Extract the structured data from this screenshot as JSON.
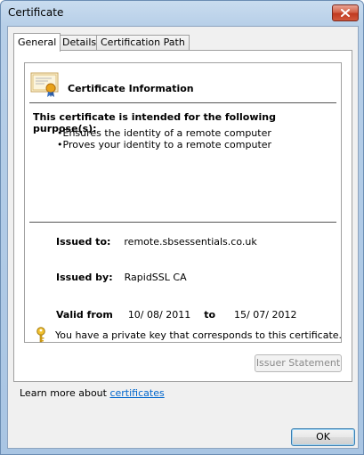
{
  "window": {
    "title": "Certificate"
  },
  "tabs": [
    {
      "label": "General",
      "active": true
    },
    {
      "label": "Details",
      "active": false
    },
    {
      "label": "Certification Path",
      "active": false
    }
  ],
  "general": {
    "section_title": "Certificate Information",
    "purpose_heading": "This certificate is intended for the following purpose(s):",
    "purposes": [
      "Ensures the identity of a remote computer",
      "Proves your identity to a remote computer"
    ],
    "issued_to_label": "Issued to:",
    "issued_to_value": "remote.sbsessentials.co.uk",
    "issued_by_label": "Issued by:",
    "issued_by_value": "RapidSSL CA",
    "valid_from_label": "Valid from",
    "valid_from_value": "10/ 08/ 2011",
    "valid_to_label": "to",
    "valid_to_value": "15/ 07/ 2012",
    "private_key_text": "You have a private key that corresponds to this certificate.",
    "issuer_statement_label": "Issuer Statement",
    "learn_more_prefix": "Learn more about ",
    "learn_more_link": "certificates"
  },
  "footer": {
    "ok_label": "OK"
  },
  "icons": {
    "certificate": "certificate-icon",
    "key": "key-icon",
    "close": "close-icon"
  },
  "colors": {
    "title_bar": "#b7cfe8",
    "close_button": "#c03a20",
    "link": "#0066cc"
  }
}
